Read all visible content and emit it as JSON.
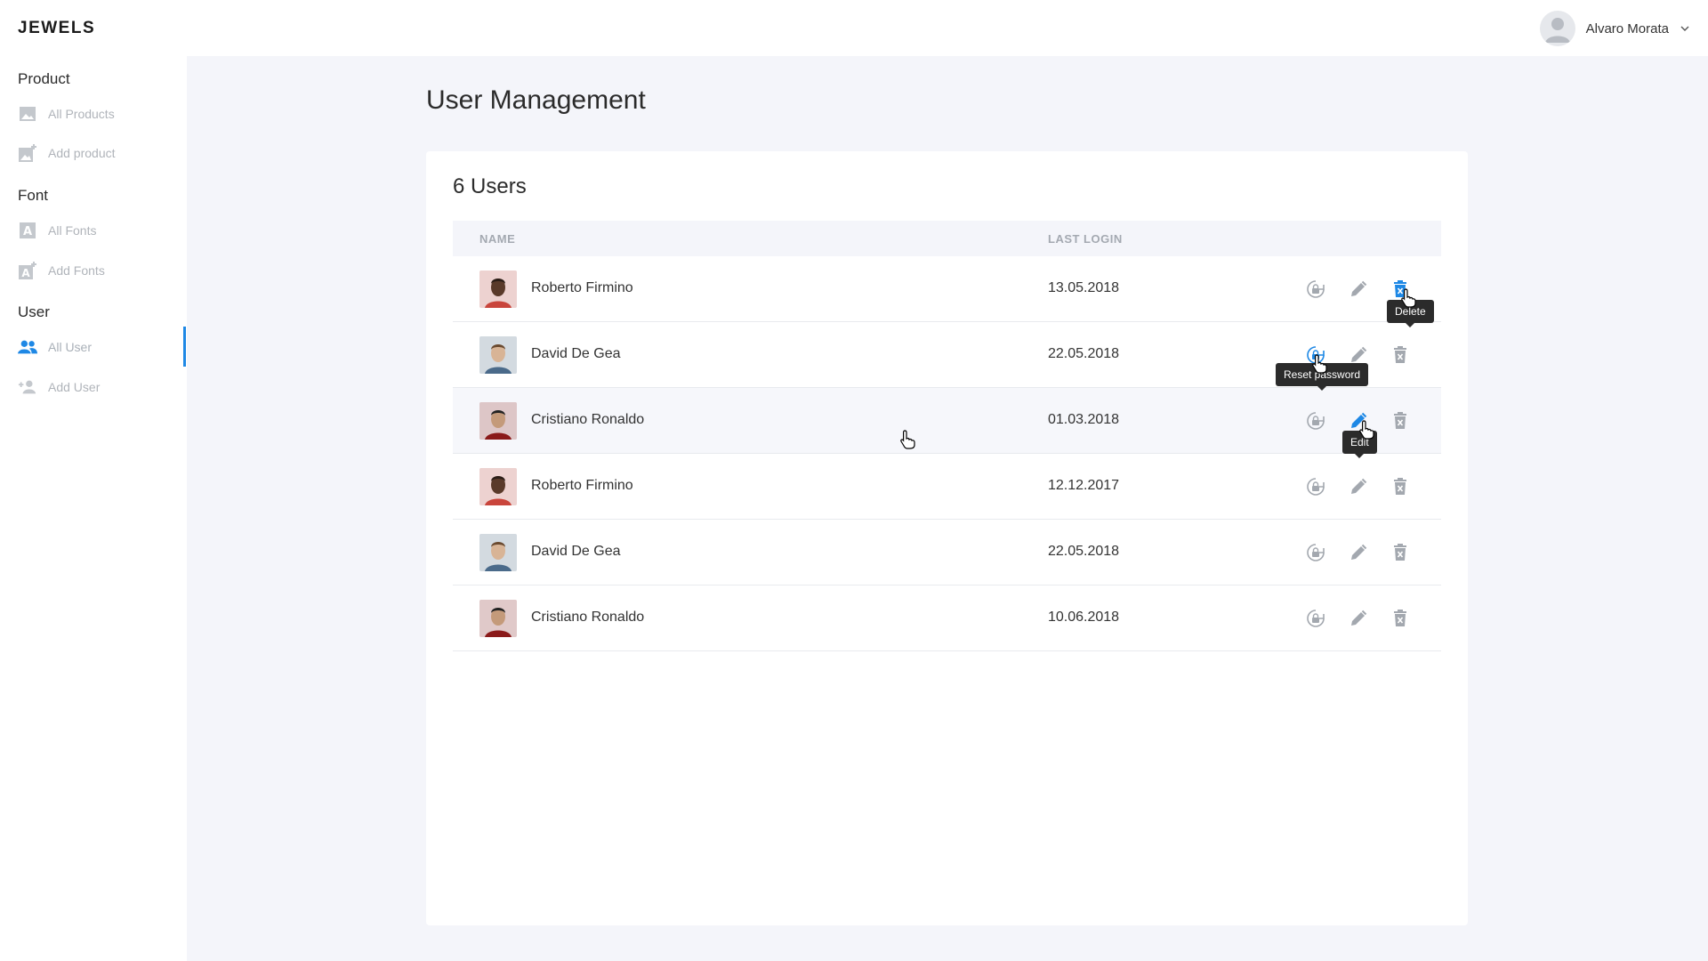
{
  "app": {
    "logo": "JEWELS"
  },
  "account": {
    "name": "Alvaro Morata"
  },
  "sidebar": {
    "sections": [
      {
        "title": "Product",
        "items": [
          {
            "label": "All Products",
            "icon": "image-icon"
          },
          {
            "label": "Add product",
            "icon": "add-image-icon"
          }
        ]
      },
      {
        "title": "Font",
        "items": [
          {
            "label": "All Fonts",
            "icon": "font-icon"
          },
          {
            "label": "Add Fonts",
            "icon": "add-font-icon"
          }
        ]
      },
      {
        "title": "User",
        "items": [
          {
            "label": "All User",
            "icon": "users-icon",
            "active": true
          },
          {
            "label": "Add User",
            "icon": "add-user-icon"
          }
        ]
      }
    ]
  },
  "page": {
    "title": "User Management"
  },
  "card": {
    "title": "6 Users"
  },
  "table": {
    "headers": {
      "name": "NAME",
      "last_login": "LAST LOGIN"
    },
    "rows": [
      {
        "name": "Roberto Firmino",
        "last_login": "13.05.2018"
      },
      {
        "name": "David De Gea",
        "last_login": "22.05.2018"
      },
      {
        "name": "Cristiano Ronaldo",
        "last_login": "01.03.2018"
      },
      {
        "name": "Roberto Firmino",
        "last_login": "12.12.2017"
      },
      {
        "name": "David De Gea",
        "last_login": "22.05.2018"
      },
      {
        "name": "Cristiano Ronaldo",
        "last_login": "10.06.2018"
      }
    ]
  },
  "tooltips": {
    "delete": "Delete",
    "reset": "Reset password",
    "edit": "Edit"
  },
  "colors": {
    "accent": "#1e88e5",
    "icon_gray": "#a3a8af",
    "bg": "#f4f5fa"
  }
}
